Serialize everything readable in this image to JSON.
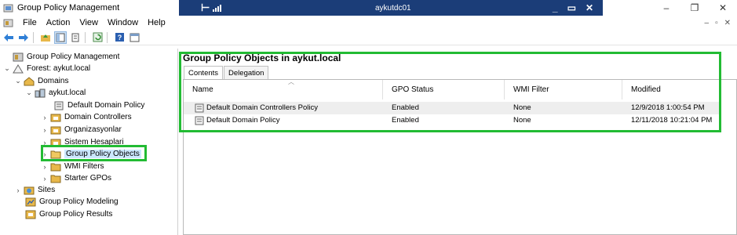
{
  "window": {
    "title": "Group Policy Management",
    "controls": [
      "–",
      "❐",
      "✕"
    ]
  },
  "remote_bar": {
    "host": "aykutdc01",
    "controls": [
      "_",
      "▭",
      "✕"
    ]
  },
  "menu": {
    "items": [
      "File",
      "Action",
      "View",
      "Window",
      "Help"
    ],
    "mdi_controls": [
      "–",
      "▫",
      "✕"
    ]
  },
  "toolbar": {
    "buttons": [
      "back-icon",
      "forward-icon",
      "up-folder-icon",
      "show-tree-icon",
      "properties-icon",
      "refresh-icon",
      "help-icon",
      "console-icon"
    ]
  },
  "tree": {
    "items": [
      {
        "label": "Group Policy Management",
        "expander": "",
        "icon": "gpm-icon"
      },
      {
        "label": "Forest: aykut.local",
        "expander": "⌄",
        "icon": "forest-icon"
      },
      {
        "label": "Domains",
        "expander": "⌄",
        "icon": "domains-icon"
      },
      {
        "label": "aykut.local",
        "expander": "⌄",
        "icon": "domain-icon"
      },
      {
        "label": "Default Domain Policy",
        "expander": "",
        "icon": "gpo-link-icon"
      },
      {
        "label": "Domain Controllers",
        "expander": "›",
        "icon": "ou-icon"
      },
      {
        "label": "Organizasyonlar",
        "expander": "›",
        "icon": "ou-icon"
      },
      {
        "label": "Sistem Hesaplari",
        "expander": "›",
        "icon": "ou-icon"
      },
      {
        "label": "Group Policy Objects",
        "expander": "›",
        "icon": "gpo-folder-icon"
      },
      {
        "label": "WMI Filters",
        "expander": "›",
        "icon": "wmi-folder-icon"
      },
      {
        "label": "Starter GPOs",
        "expander": "›",
        "icon": "starter-folder-icon"
      },
      {
        "label": "Sites",
        "expander": "›",
        "icon": "sites-icon"
      },
      {
        "label": "Group Policy Modeling",
        "expander": "",
        "icon": "modeling-icon"
      },
      {
        "label": "Group Policy Results",
        "expander": "",
        "icon": "results-icon"
      }
    ]
  },
  "right": {
    "title": "Group Policy Objects in aykut.local",
    "tabs": [
      "Contents",
      "Delegation"
    ],
    "columns": [
      "Name",
      "GPO Status",
      "WMI Filter",
      "Modified"
    ],
    "rows": [
      {
        "name": "Default Domain Controllers Policy",
        "status": "Enabled",
        "wmi": "None",
        "modified": "12/9/2018 1:00:54 PM"
      },
      {
        "name": "Default Domain Policy",
        "status": "Enabled",
        "wmi": "None",
        "modified": "12/11/2018 10:21:04 PM"
      }
    ]
  },
  "colors": {
    "highlight": "#22bb33",
    "remote_bar": "#1b3d78",
    "folder": "#e8b84a"
  }
}
